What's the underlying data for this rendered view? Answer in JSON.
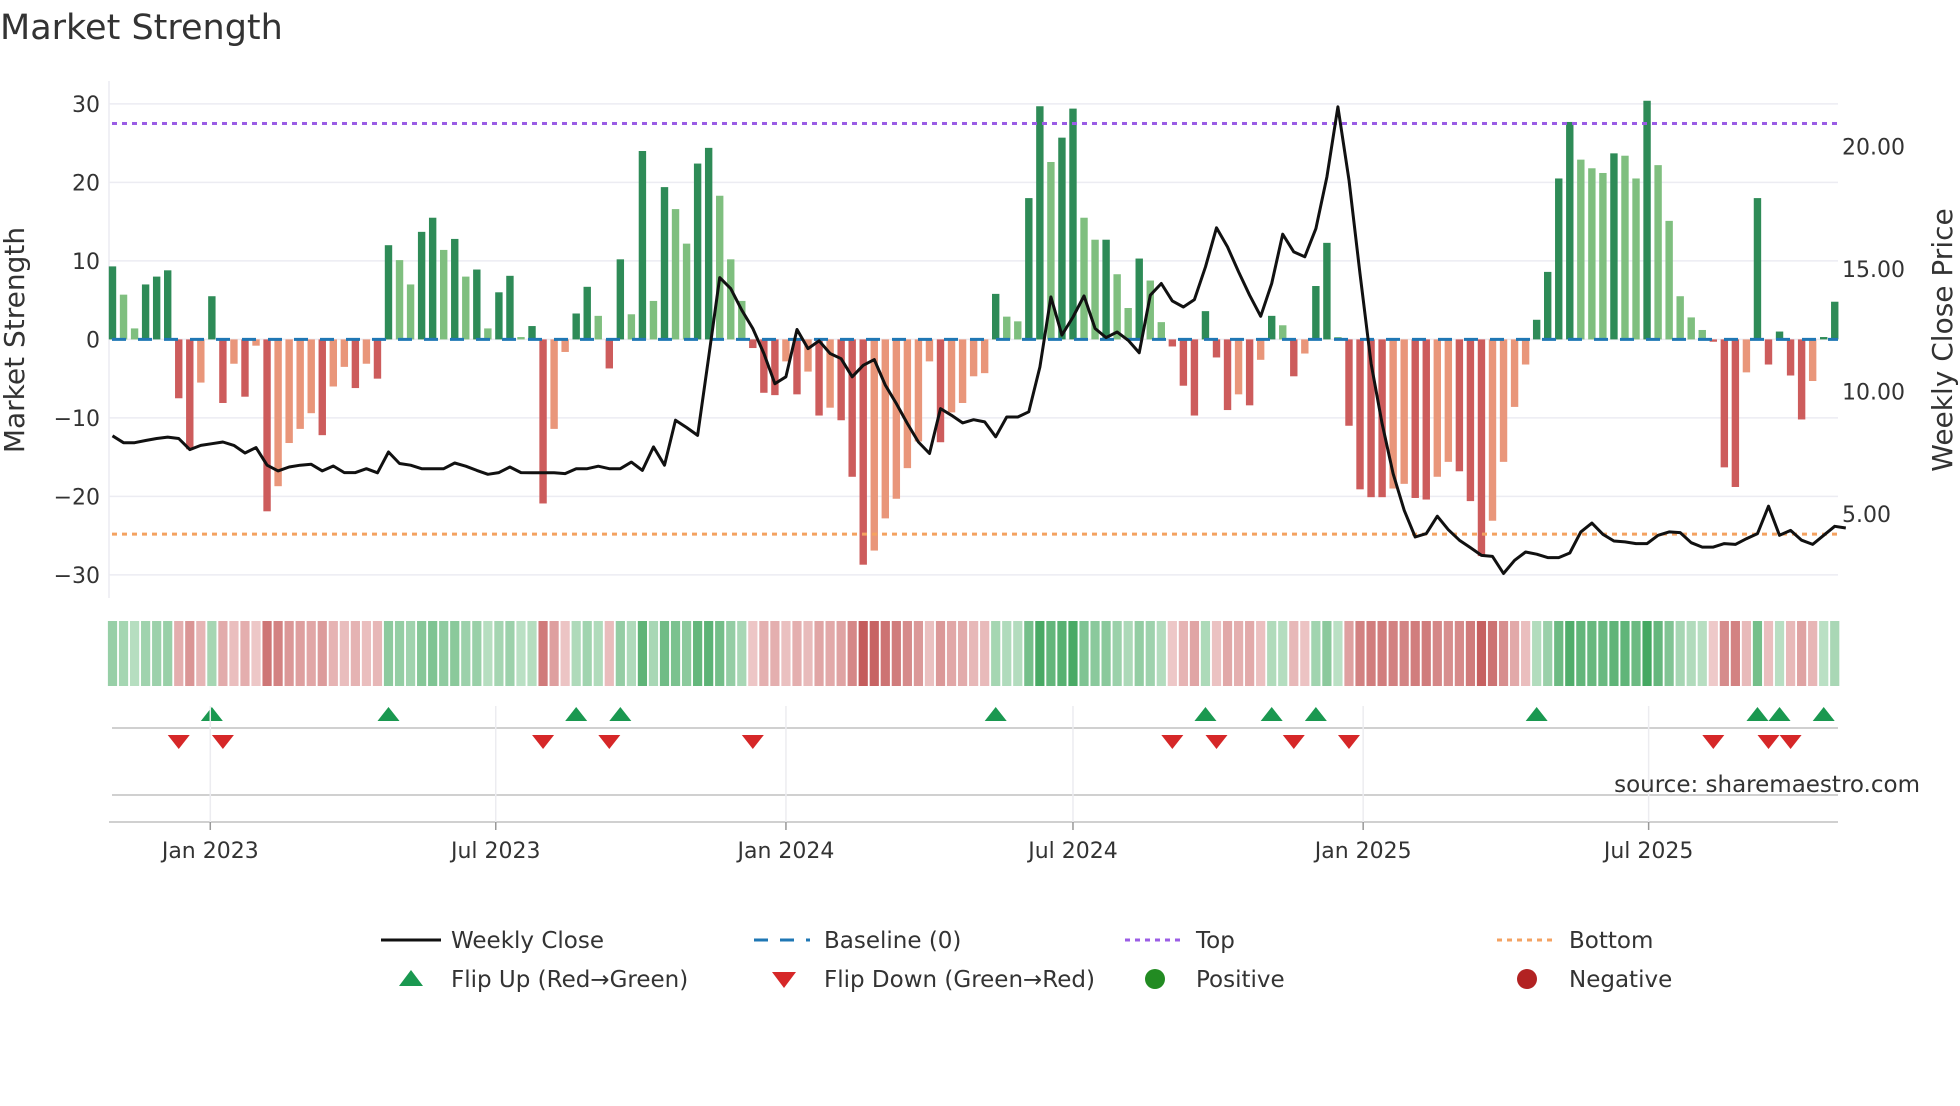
{
  "chart_data": {
    "type": "bar",
    "title": "Market Strength",
    "ylabel": "Market Strength",
    "y2label": "Weekly Close Price",
    "ylim": [
      -33,
      33
    ],
    "y2lim": [
      1.9,
      23.3
    ],
    "yticks": [
      -30,
      -20,
      -10,
      0,
      10,
      20,
      30
    ],
    "yticklabels": [
      "−30",
      "−20",
      "−10",
      "0",
      "10",
      "20",
      "30"
    ],
    "y2ticks": [
      5,
      10,
      15,
      20
    ],
    "y2ticklabels": [
      "5.00",
      "10.00",
      "15.00",
      "20.00"
    ],
    "x_start": "2022-10-31",
    "x_step_days": 7,
    "xticks": [
      {
        "date": "2023-01-01",
        "label": "Jan 2023"
      },
      {
        "date": "2023-07-01",
        "label": "Jul 2023"
      },
      {
        "date": "2024-01-01",
        "label": "Jan 2024"
      },
      {
        "date": "2024-07-01",
        "label": "Jul 2024"
      },
      {
        "date": "2025-01-01",
        "label": "Jan 2025"
      },
      {
        "date": "2025-07-01",
        "label": "Jul 2025"
      }
    ],
    "top_level": 27.5,
    "bottom_level": -24.8,
    "baseline": 0,
    "strength": [
      9.3,
      5.7,
      1.4,
      7.0,
      8.0,
      8.8,
      -7.5,
      -14.0,
      -5.5,
      5.5,
      -8.1,
      -3.1,
      -7.3,
      -0.8,
      -21.9,
      -18.7,
      -13.2,
      -11.4,
      -9.4,
      -12.2,
      -6.0,
      -3.5,
      -6.2,
      -3.1,
      -5.0,
      12.0,
      10.1,
      7.0,
      13.7,
      15.5,
      11.4,
      12.8,
      8.0,
      8.9,
      1.4,
      6.0,
      8.1,
      0.3,
      1.7,
      -20.9,
      -11.4,
      -1.6,
      3.3,
      6.7,
      3.0,
      -3.7,
      10.2,
      3.2,
      24.0,
      4.9,
      19.4,
      16.6,
      12.2,
      22.4,
      24.4,
      18.3,
      10.2,
      4.9,
      -1.1,
      -6.8,
      -7.1,
      -2.8,
      -7.0,
      -4.1,
      -9.7,
      -8.7,
      -10.3,
      -17.5,
      -28.7,
      -26.9,
      -22.8,
      -20.3,
      -16.4,
      -13.0,
      -2.8,
      -13.1,
      -9.3,
      -8.1,
      -4.7,
      -4.3,
      5.8,
      2.9,
      2.3,
      18.0,
      29.7,
      22.6,
      25.7,
      29.4,
      15.5,
      12.7,
      12.7,
      8.3,
      4.0,
      10.3,
      7.5,
      2.2,
      -0.9,
      -5.9,
      -9.7,
      3.6,
      -2.3,
      -9.0,
      -7.0,
      -8.4,
      -2.6,
      3.0,
      1.8,
      -4.7,
      -1.8,
      6.8,
      12.3,
      0.3,
      -11.0,
      -19.1,
      -20.1,
      -20.1,
      -19.0,
      -18.4,
      -20.2,
      -20.4,
      -17.5,
      -15.6,
      -16.8,
      -20.6,
      -27.6,
      -23.1,
      -15.6,
      -8.6,
      -3.2,
      2.5,
      8.6,
      20.5,
      27.7,
      22.9,
      21.8,
      21.2,
      23.7,
      23.4,
      20.5,
      30.4,
      22.2,
      15.1,
      5.5,
      2.8,
      1.2,
      -0.3,
      -16.3,
      -18.8,
      -4.2,
      18.0,
      -3.2,
      1.0,
      -4.6,
      -10.2,
      -5.3,
      0.3,
      4.8
    ],
    "weekly_close": [
      8.19,
      7.91,
      7.91,
      8.0,
      8.08,
      8.14,
      8.08,
      7.63,
      7.8,
      7.87,
      7.94,
      7.8,
      7.49,
      7.71,
      6.99,
      6.76,
      6.92,
      6.99,
      7.03,
      6.76,
      6.96,
      6.69,
      6.69,
      6.85,
      6.68,
      7.53,
      7.06,
      6.99,
      6.85,
      6.85,
      6.85,
      7.08,
      6.95,
      6.78,
      6.62,
      6.69,
      6.92,
      6.69,
      6.68,
      6.68,
      6.68,
      6.65,
      6.85,
      6.85,
      6.95,
      6.85,
      6.85,
      7.12,
      6.78,
      7.74,
      6.99,
      8.83,
      8.53,
      8.21,
      11.41,
      14.65,
      14.2,
      13.32,
      12.57,
      11.55,
      10.32,
      10.6,
      12.53,
      11.75,
      12.07,
      11.55,
      11.34,
      10.6,
      11.07,
      11.3,
      10.26,
      9.51,
      8.69,
      7.94,
      7.47,
      9.3,
      9.03,
      8.72,
      8.85,
      8.76,
      8.15,
      8.96,
      8.96,
      9.17,
      11.0,
      13.86,
      12.3,
      13.04,
      13.9,
      12.57,
      12.2,
      12.43,
      12.09,
      11.58,
      13.93,
      14.41,
      13.7,
      13.45,
      13.75,
      15.09,
      16.68,
      15.9,
      14.88,
      13.93,
      13.07,
      14.41,
      16.42,
      15.7,
      15.5,
      16.65,
      18.76,
      21.62,
      18.63,
      14.81,
      11.14,
      8.69,
      6.65,
      5.15,
      4.06,
      4.2,
      4.91,
      4.36,
      3.93,
      3.63,
      3.31,
      3.27,
      2.57,
      3.11,
      3.45,
      3.36,
      3.22,
      3.22,
      3.41,
      4.27,
      4.63,
      4.17,
      3.9,
      3.86,
      3.79,
      3.79,
      4.13,
      4.27,
      4.24,
      3.83,
      3.65,
      3.65,
      3.79,
      3.76,
      3.99,
      4.2,
      5.32,
      4.13,
      4.33,
      3.93,
      3.76,
      4.13,
      4.5,
      4.43
    ],
    "legend": {
      "placement": "bottom",
      "entries": [
        {
          "label": "Weekly Close",
          "kind": "line"
        },
        {
          "label": "Baseline (0)",
          "kind": "dashed"
        },
        {
          "label": "Top",
          "kind": "dotted"
        },
        {
          "label": "Bottom",
          "kind": "dotted"
        },
        {
          "label": "Flip Up (Red→Green)",
          "kind": "triangle-up"
        },
        {
          "label": "Flip Down (Green→Red)",
          "kind": "triangle-down"
        },
        {
          "label": "Positive",
          "kind": "circle"
        },
        {
          "label": "Negative",
          "kind": "circle"
        }
      ]
    },
    "grid": true
  },
  "source": "source: sharemaestro.com",
  "colors": {
    "pos_strong": "#2e8b57",
    "pos_weak": "#7fbf7f",
    "neg_strong": "#cd5c5c",
    "neg_weak": "#e9967a",
    "baseline": "#1f77b4",
    "top": "#9b5de5",
    "bottom": "#f4a261",
    "flip_up": "#1a9850",
    "flip_down": "#d62728",
    "positive": "#228b22",
    "negative": "#b22222",
    "line": "#111111"
  }
}
